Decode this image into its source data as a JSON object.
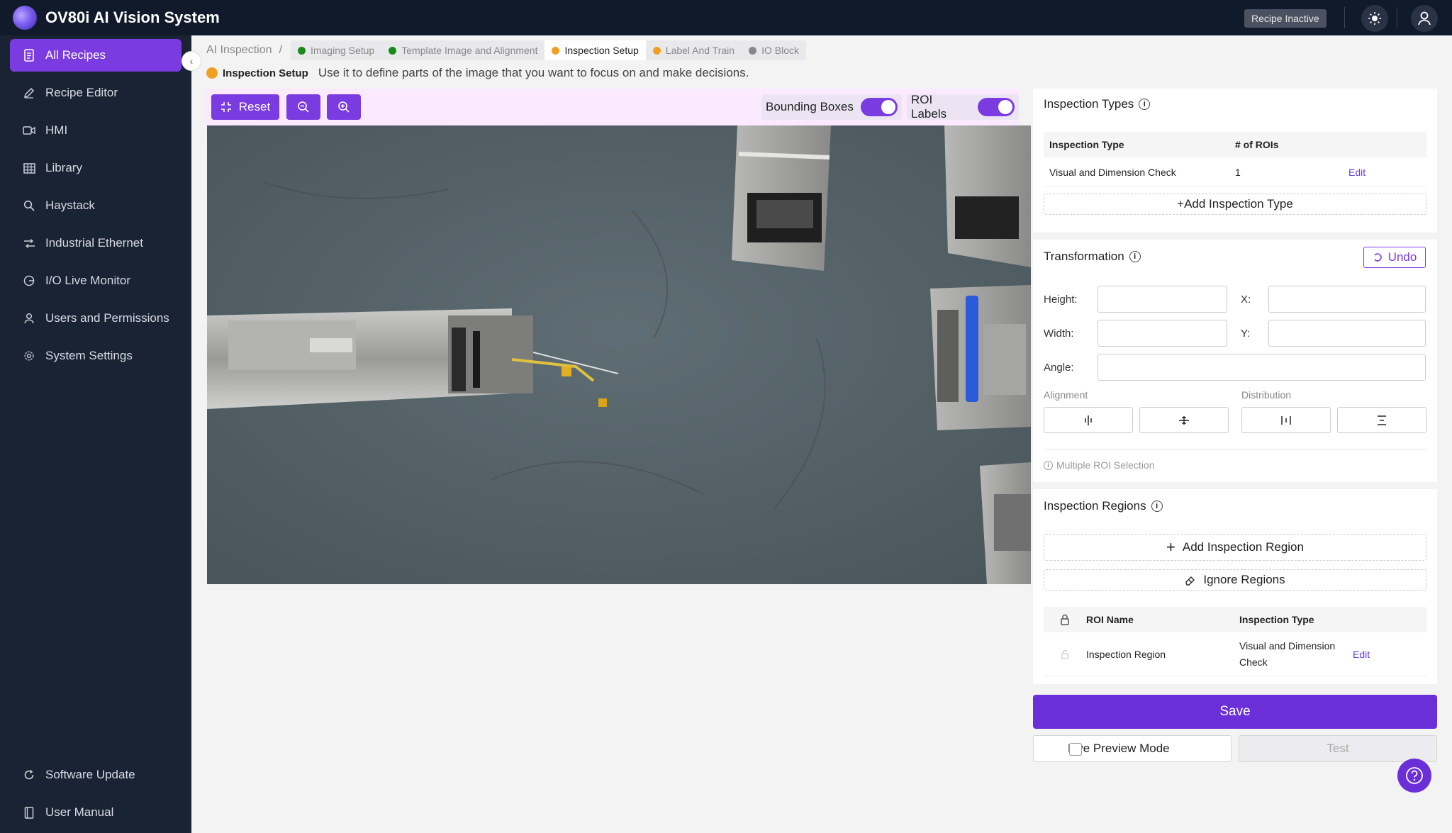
{
  "app": {
    "title": "OV80i AI Vision System",
    "recipe_status": "Recipe Inactive",
    "theme_icon": "sun-icon",
    "user_icon": "user-icon"
  },
  "sidebar": {
    "items": [
      {
        "label": "All Recipes",
        "icon": "document-icon",
        "active": true
      },
      {
        "label": "Recipe Editor",
        "icon": "pencil-icon"
      },
      {
        "label": "HMI",
        "icon": "video-icon"
      },
      {
        "label": "Library",
        "icon": "grid-icon"
      },
      {
        "label": "Haystack",
        "icon": "search-icon"
      },
      {
        "label": "Industrial Ethernet",
        "icon": "network-icon"
      },
      {
        "label": "I/O Live Monitor",
        "icon": "monitor-icon"
      },
      {
        "label": "Users and Permissions",
        "icon": "user-icon"
      },
      {
        "label": "System Settings",
        "icon": "gear-icon"
      }
    ],
    "bottom_items": [
      {
        "label": "Software Update",
        "icon": "refresh-icon"
      },
      {
        "label": "User Manual",
        "icon": "book-icon"
      }
    ]
  },
  "breadcrumb": {
    "root": "AI Inspection",
    "separator": "/",
    "steps": [
      {
        "label": "Imaging Setup",
        "color": "#1a8a1a"
      },
      {
        "label": "Template Image and Alignment",
        "color": "#1a8a1a"
      },
      {
        "label": "Inspection Setup",
        "color": "#f0a020",
        "active": true
      },
      {
        "label": "Label And Train",
        "color": "#f0a020"
      },
      {
        "label": "IO Block",
        "color": "#888888"
      }
    ]
  },
  "subheader": {
    "label": "Inspection Setup",
    "description": "Use it to define parts of the image that you want to focus on and make decisions."
  },
  "toolbar": {
    "reset_label": "Reset",
    "bounding_boxes_label": "Bounding Boxes",
    "roi_labels_label": "ROI Labels",
    "bounding_boxes_on": true,
    "roi_labels_on": true
  },
  "inspection_types": {
    "title": "Inspection Types",
    "columns": [
      "Inspection Type",
      "# of ROIs"
    ],
    "rows": [
      {
        "type": "Visual and Dimension Check",
        "count": "1",
        "action": "Edit"
      }
    ],
    "add_label": "+Add Inspection Type"
  },
  "transformation": {
    "title": "Transformation",
    "undo_label": "Undo",
    "height_label": "Height:",
    "width_label": "Width:",
    "x_label": "X:",
    "y_label": "Y:",
    "angle_label": "Angle:",
    "alignment_label": "Alignment",
    "distribution_label": "Distribution",
    "multi_roi_hint": "Multiple ROI Selection"
  },
  "inspection_regions": {
    "title": "Inspection Regions",
    "add_label": "Add Inspection Region",
    "ignore_label": "Ignore Regions",
    "columns": [
      "ROI Name",
      "Inspection Type"
    ],
    "rows": [
      {
        "name": "Inspection Region",
        "type_line1": "Visual and Dimension",
        "type_line2": "Check",
        "action": "Edit"
      }
    ]
  },
  "actions": {
    "save_label": "Save",
    "live_preview_label": "Live Preview Mode",
    "test_label": "Test"
  },
  "colors": {
    "accent": "#7a3be0",
    "sidebar_bg": "#1a2333",
    "topbar_bg": "#111a2b"
  }
}
